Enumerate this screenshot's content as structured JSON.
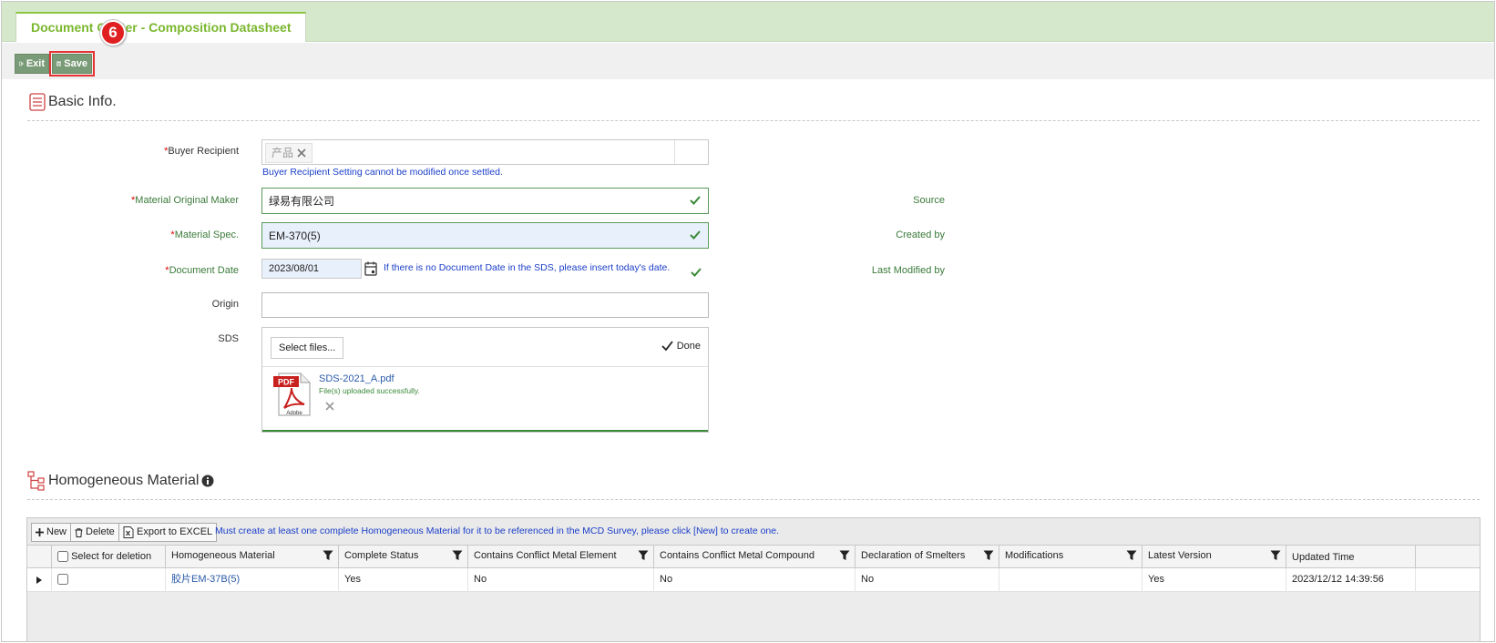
{
  "tab": {
    "title": "Document Center - Composition Datasheet"
  },
  "toolbar": {
    "exit_label": "Exit",
    "save_label": "Save",
    "step_badge": "6"
  },
  "basic": {
    "title": "Basic Info.",
    "buyer_label": "Buyer Recipient",
    "buyer_chip": "产品",
    "buyer_hint": "Buyer Recipient Setting cannot be modified once settled.",
    "maker_label": "Material Original Maker",
    "maker_value": "绿易有限公司",
    "spec_label": "Material Spec.",
    "spec_value": "EM-370(5)",
    "date_label": "Document Date",
    "date_value": "2023/08/01",
    "date_hint": "If there is no Document Date in the SDS, please insert today's date.",
    "origin_label": "Origin",
    "sds_label": "SDS",
    "select_files": "Select files...",
    "done_label": "Done",
    "file_name": "SDS-2021_A.pdf",
    "file_status": "File(s) uploaded successfully.",
    "pdf_badge": "PDF",
    "pdf_brand": "Adobe",
    "source_label": "Source",
    "created_label": "Created by",
    "modified_label": "Last Modified by"
  },
  "homog": {
    "title": "Homogeneous Material",
    "new_label": "New",
    "delete_label": "Delete",
    "export_label": "Export to EXCEL",
    "hint": "Must create at least one complete Homogeneous Material for it to be referenced in the MCD Survey, please click [New] to create one.",
    "columns": {
      "select": "Select for deletion",
      "material": "Homogeneous Material",
      "complete": "Complete Status",
      "element": "Contains Conflict Metal Element",
      "compound": "Contains Conflict Metal Compound",
      "smelters": "Declaration of Smelters",
      "modifications": "Modifications",
      "latest": "Latest Version",
      "updated": "Updated Time"
    },
    "rows": [
      {
        "material": "胶片EM-37B(5)",
        "complete": "Yes",
        "element": "No",
        "compound": "No",
        "smelters": "No",
        "modifications": "",
        "latest": "Yes",
        "updated": "2023/12/12 14:39:56"
      }
    ]
  },
  "colors": {
    "accent": "#7ab72e",
    "tab_bg": "#d5e8cc",
    "button": "#7a9b77",
    "hint": "#1a3ec8",
    "badge": "#e02020"
  }
}
